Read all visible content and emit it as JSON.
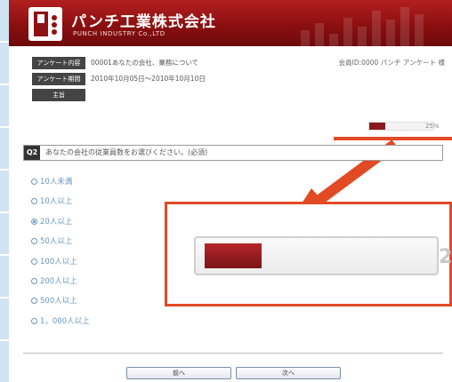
{
  "header": {
    "company_name": "パンチ工業株式会社",
    "company_name_en": "PUNCH INDUSTRY Co.,LTD"
  },
  "survey_info": {
    "rows": [
      {
        "label": "アンケート内容",
        "value": "00001あなたの会社、業務について"
      },
      {
        "label": "アンケート期間",
        "value": "2010年10月05日〜2010年10月10日"
      },
      {
        "label": "主旨",
        "value": ""
      }
    ],
    "member_text": "会員ID:0000 パンチ アンケート 様"
  },
  "progress": {
    "percent": 25,
    "label": "25%"
  },
  "question": {
    "number": "Q2",
    "text": "あなたの会社の従業員数をお選びください。(必須)",
    "options": [
      {
        "label": "10人未満",
        "selected": false
      },
      {
        "label": "10人以上",
        "selected": false
      },
      {
        "label": "20人以上",
        "selected": true
      },
      {
        "label": "50人以上",
        "selected": false
      },
      {
        "label": "100人以上",
        "selected": false
      },
      {
        "label": "200人以上",
        "selected": false
      },
      {
        "label": "500人以上",
        "selected": false
      },
      {
        "label": "1，000人以上",
        "selected": false
      }
    ]
  },
  "zoom": {
    "pct_fragment": "2"
  },
  "nav": {
    "prev_label": "前へ",
    "next_label": "次へ"
  },
  "colors": {
    "header_red": "#8c0f10",
    "accent_orange": "#e24a24",
    "option_blue": "#6a96bd",
    "progress_fill": "#8a1a1c"
  }
}
